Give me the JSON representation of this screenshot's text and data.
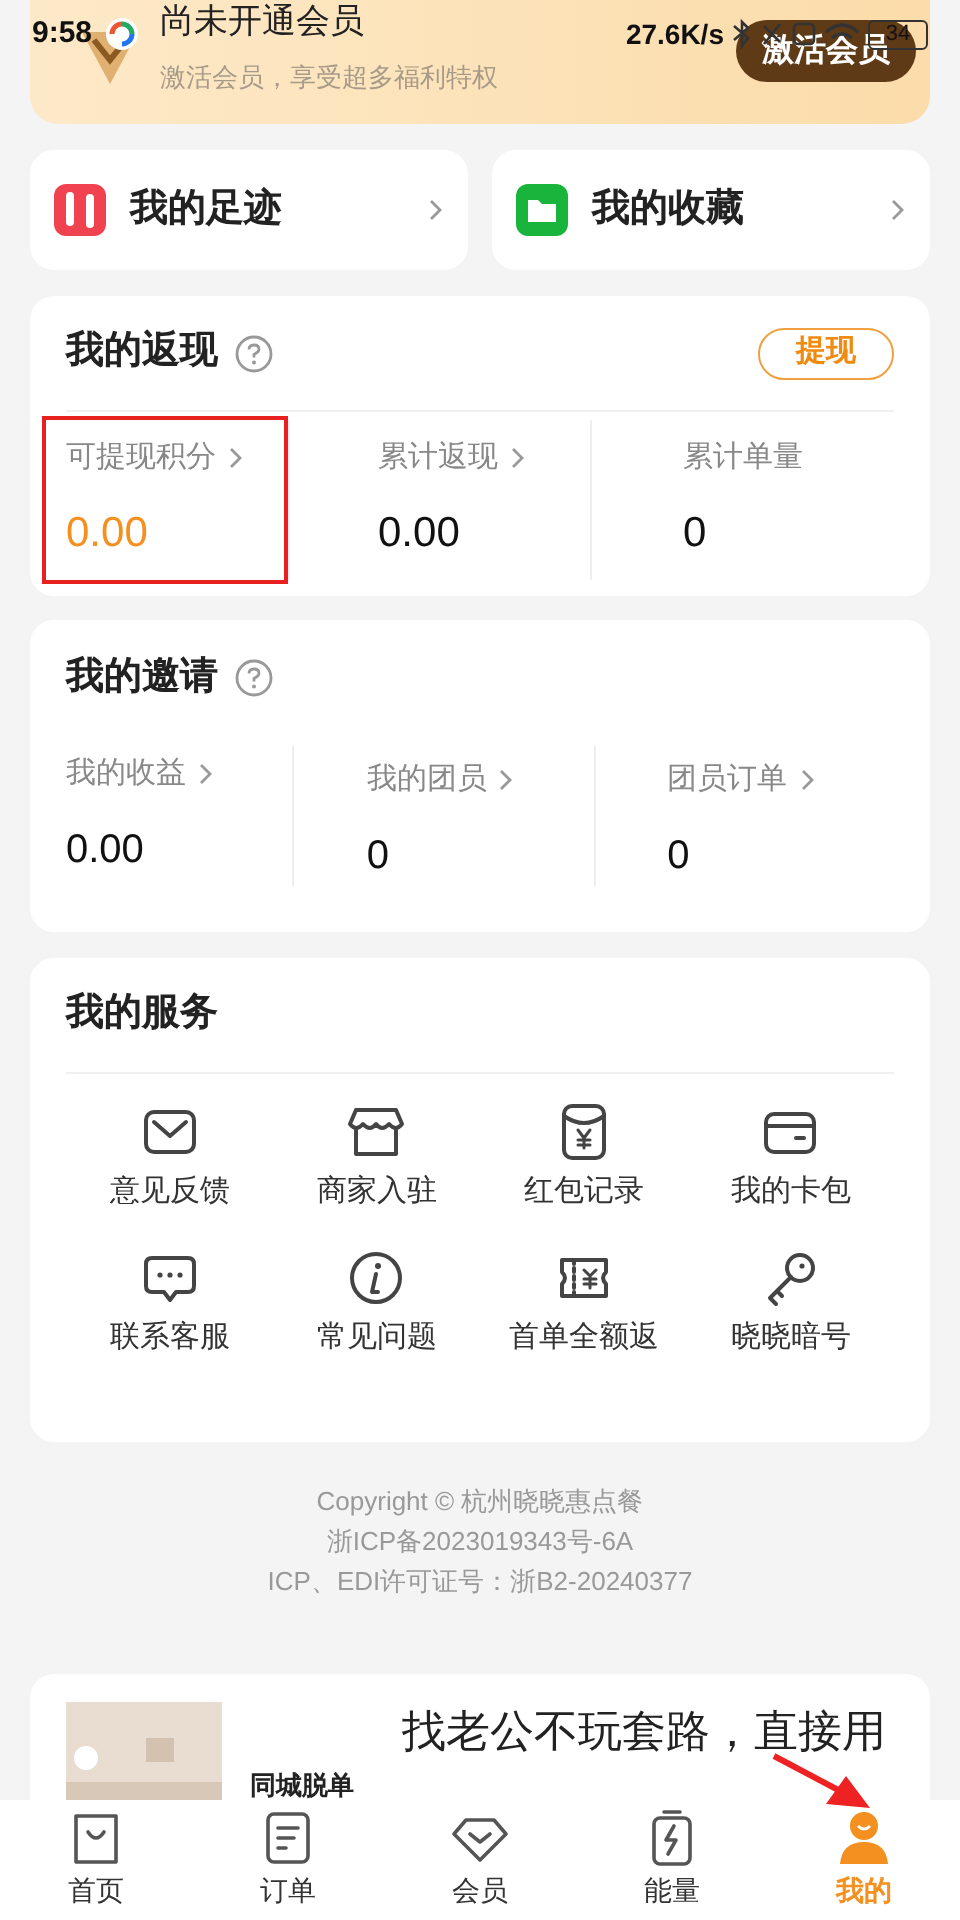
{
  "status_bar": {
    "time": "9:58",
    "speed": "27.6K/s",
    "battery": "34"
  },
  "member_card": {
    "title": "尚未开通会员",
    "subtitle": "激活会员，享受超多福利特权",
    "button": "激活会员"
  },
  "shortcuts": [
    {
      "label": "我的足迹",
      "color": "#f0424f"
    },
    {
      "label": "我的收藏",
      "color": "#19b43c"
    }
  ],
  "cashback": {
    "title": "我的返现",
    "button": "提现",
    "stats": [
      {
        "label": "可提现积分",
        "value": "0.00",
        "link": true,
        "accent": true,
        "annotated": true
      },
      {
        "label": "累计返现",
        "value": "0.00",
        "link": true,
        "accent": false,
        "annotated": false
      },
      {
        "label": "累计单量",
        "value": "0",
        "link": false,
        "accent": false,
        "annotated": false
      }
    ]
  },
  "invite": {
    "title": "我的邀请",
    "stats": [
      {
        "label": "我的收益",
        "value": "0.00",
        "link": true
      },
      {
        "label": "我的团员",
        "value": "0",
        "link": true
      },
      {
        "label": "团员订单",
        "value": "0",
        "link": true
      }
    ]
  },
  "services": {
    "title": "我的服务",
    "items": [
      {
        "kind": "mail",
        "label": "意见反馈"
      },
      {
        "kind": "shop",
        "label": "商家入驻"
      },
      {
        "kind": "envelope",
        "label": "红包记录"
      },
      {
        "kind": "card",
        "label": "我的卡包"
      },
      {
        "kind": "chat",
        "label": "联系客服"
      },
      {
        "kind": "info",
        "label": "常见问题"
      },
      {
        "kind": "ticket",
        "label": "首单全额返"
      },
      {
        "kind": "key",
        "label": "晓晓暗号"
      }
    ]
  },
  "footer": [
    "Copyright © 杭州晓晓惠点餐",
    "浙ICP备2023019343号-6A",
    "ICP、EDI许可证号：浙B2-20240377"
  ],
  "ad": {
    "tag": "同城脱单",
    "headline": "找老公不玩套路，直接用"
  },
  "nav": [
    {
      "kind": "bag",
      "label": "首页",
      "selected": false,
      "annotated": false
    },
    {
      "kind": "list",
      "label": "订单",
      "selected": false,
      "annotated": false
    },
    {
      "kind": "diamond",
      "label": "会员",
      "selected": false,
      "annotated": false
    },
    {
      "kind": "bolt",
      "label": "能量",
      "selected": false,
      "annotated": false
    },
    {
      "kind": "person",
      "label": "我的",
      "selected": true,
      "annotated": true
    }
  ]
}
